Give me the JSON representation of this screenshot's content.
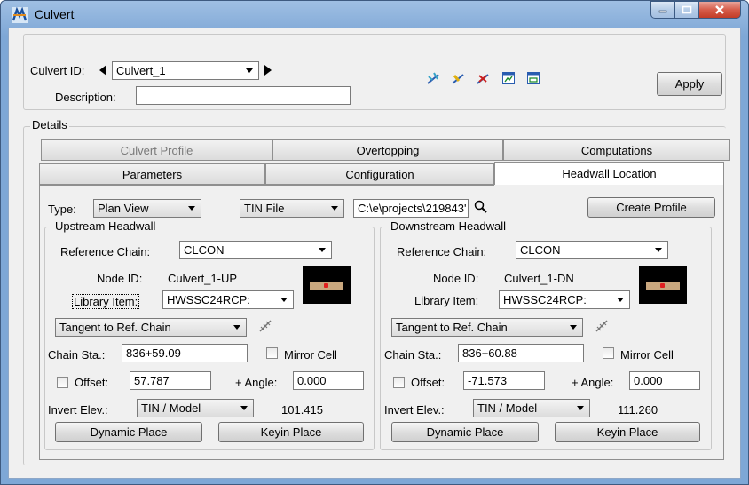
{
  "window": {
    "title": "Culvert"
  },
  "header": {
    "culvert_id_label": "Culvert ID:",
    "culvert_id_value": "Culvert_1",
    "description_label": "Description:",
    "description_value": "",
    "apply_label": "Apply"
  },
  "details": {
    "label": "Details",
    "tabs_row1": [
      "Culvert Profile",
      "Overtopping",
      "Computations"
    ],
    "tabs_row2": [
      "Parameters",
      "Configuration",
      "Headwall Location"
    ]
  },
  "headwall": {
    "type_label": "Type:",
    "type_value": "Plan View",
    "tin_value": "TIN File",
    "path_value": "C:\\e\\projects\\219843'",
    "create_profile_label": "Create Profile",
    "upstream": {
      "title": "Upstream Headwall",
      "ref_chain_label": "Reference Chain:",
      "ref_chain_value": "CLCON",
      "node_id_label": "Node ID:",
      "node_id_value": "Culvert_1-UP",
      "library_item_label": "Library Item:",
      "library_item_value": "HWSSC24RCP:",
      "tangent_value": "Tangent to Ref. Chain",
      "chain_sta_label": "Chain Sta.:",
      "chain_sta_value": "836+59.09",
      "mirror_label": "Mirror Cell",
      "offset_label": "Offset:",
      "offset_value": "57.787",
      "angle_label": "+ Angle:",
      "angle_value": "0.000",
      "invert_label": "Invert Elev.:",
      "invert_mode": "TIN / Model",
      "invert_value": "101.415",
      "dynamic_label": "Dynamic Place",
      "keyin_label": "Keyin Place"
    },
    "downstream": {
      "title": "Downstream Headwall",
      "ref_chain_label": "Reference Chain:",
      "ref_chain_value": "CLCON",
      "node_id_label": "Node ID:",
      "node_id_value": "Culvert_1-DN",
      "library_item_label": "Library Item:",
      "library_item_value": "HWSSC24RCP:",
      "tangent_value": "Tangent to Ref. Chain",
      "chain_sta_label": "Chain Sta.:",
      "chain_sta_value": "836+60.88",
      "mirror_label": "Mirror Cell",
      "offset_label": "Offset:",
      "offset_value": "-71.573",
      "angle_label": "+ Angle:",
      "angle_value": "0.000",
      "invert_label": "Invert Elev.:",
      "invert_mode": "TIN / Model",
      "invert_value": "111.260",
      "dynamic_label": "Dynamic Place",
      "keyin_label": "Keyin Place"
    }
  },
  "colors": {
    "title_bar": "#7ea7d6",
    "close_button": "#c23c27",
    "panel": "#f0f0f0"
  }
}
